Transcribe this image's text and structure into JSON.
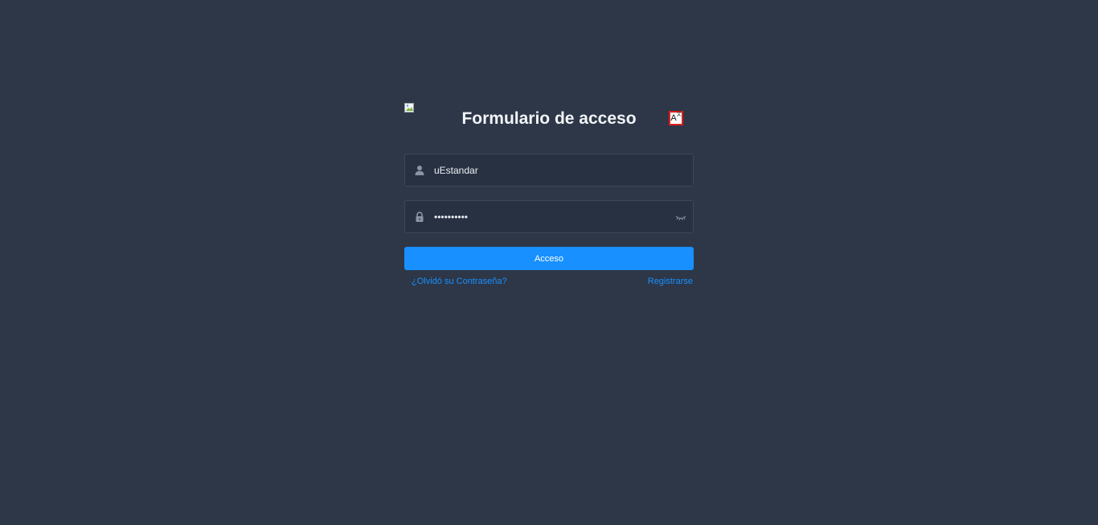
{
  "header": {
    "title": "Formulario de acceso",
    "lang_label": "A"
  },
  "username": {
    "value": "uEstandar",
    "icon": "user-icon"
  },
  "password": {
    "value": "••••••••••",
    "icon": "lock-icon",
    "toggle_icon": "eye-closed-icon"
  },
  "submit": {
    "label": "Acceso",
    "color": "#1890ff"
  },
  "links": {
    "forgot": "¿Olvidó su Contraseña?",
    "register": "Registrarse"
  },
  "colors": {
    "background": "#2d3748",
    "input_background": "#283142",
    "link": "#1890ff"
  }
}
